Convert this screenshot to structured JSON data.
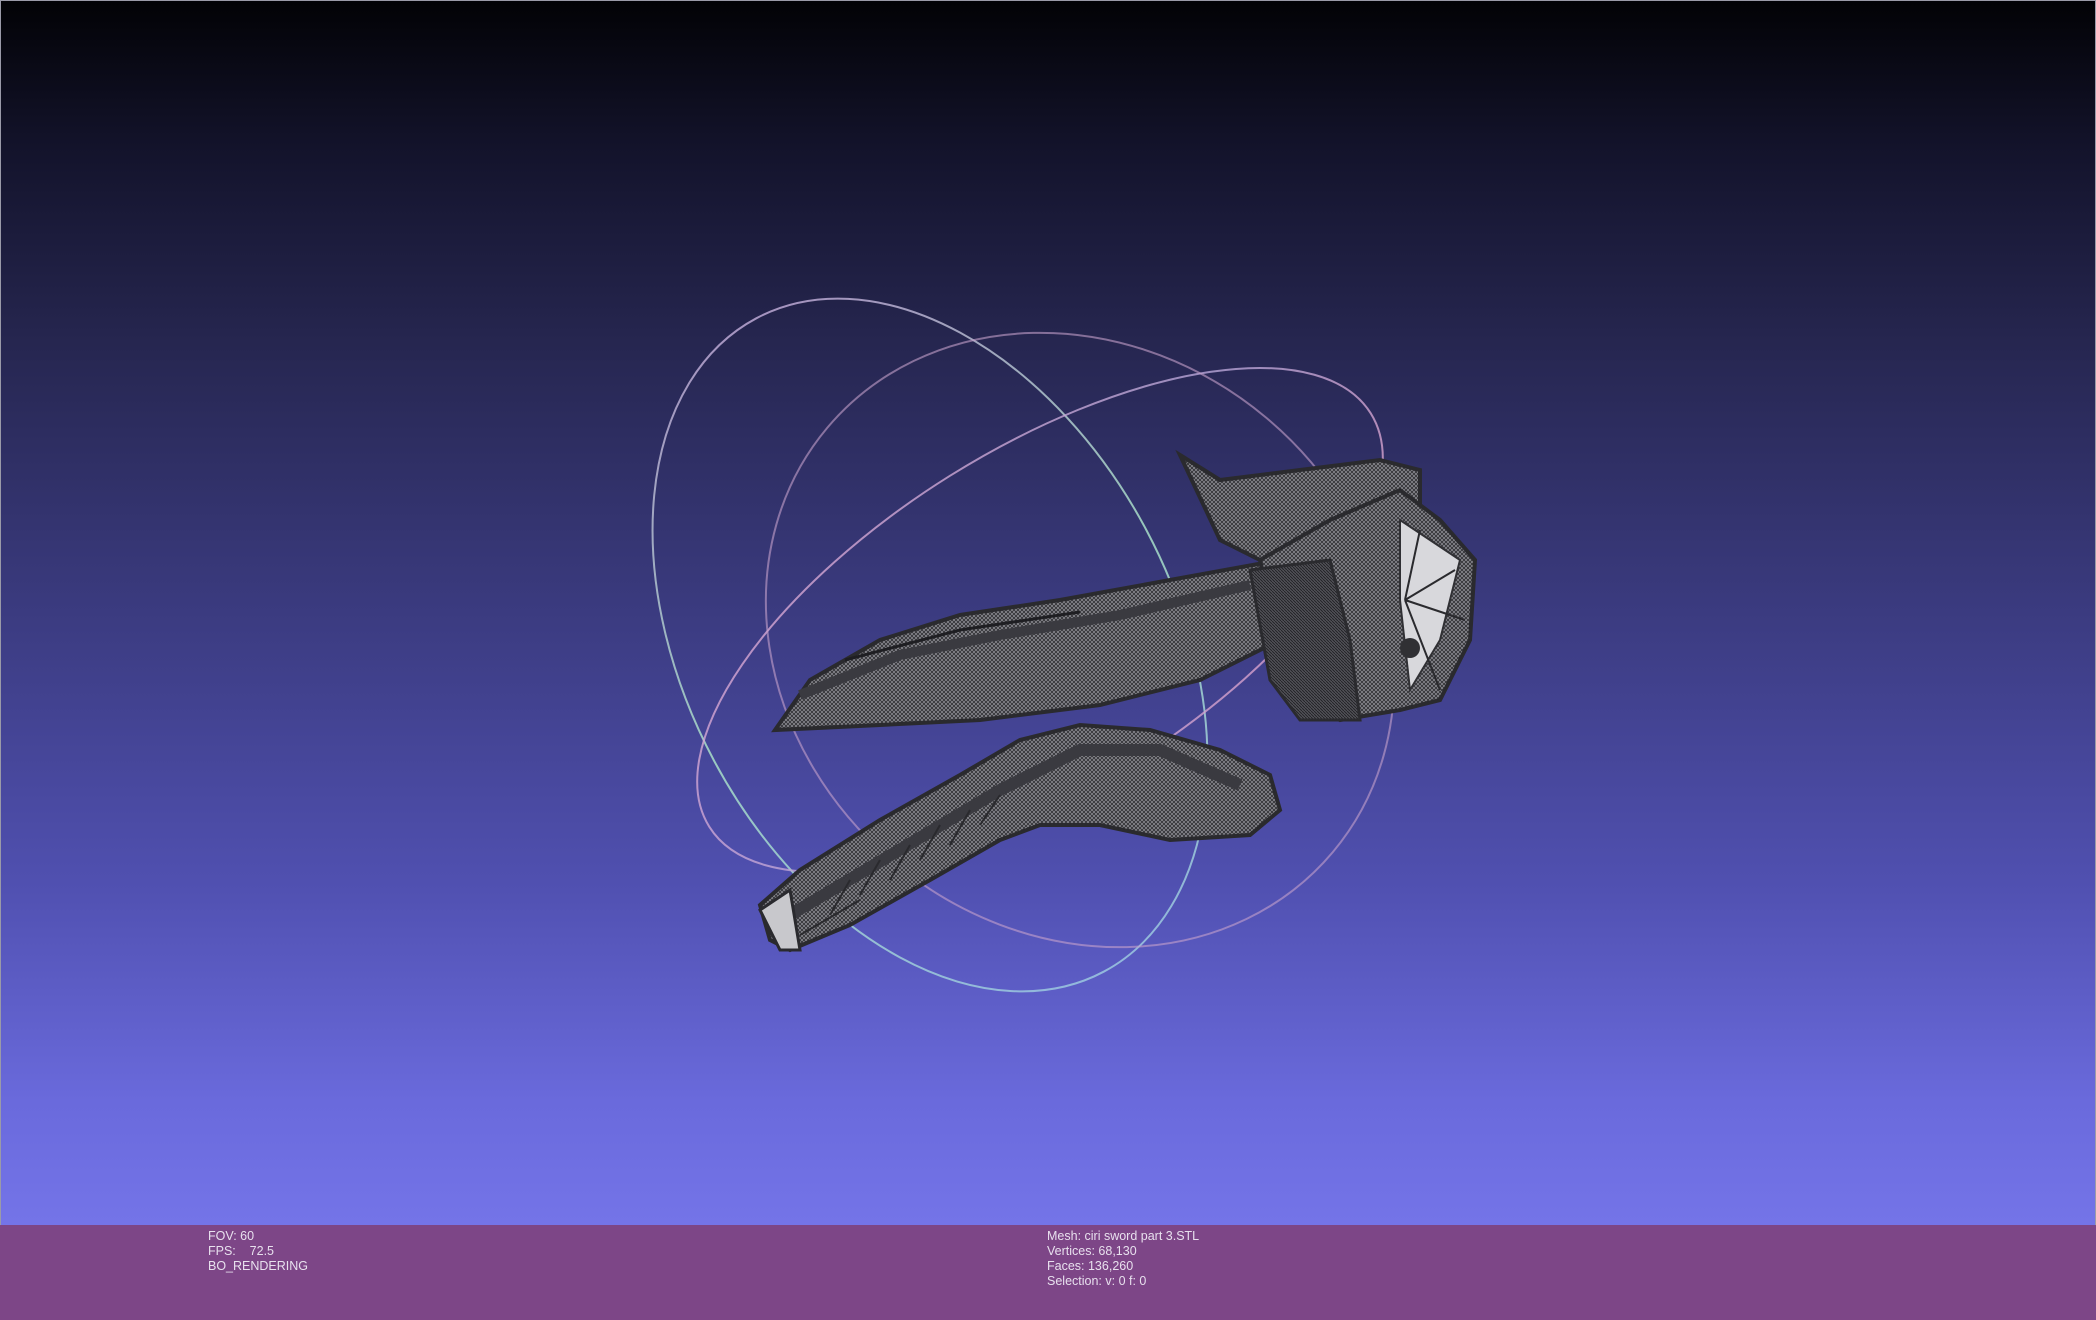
{
  "viewer": {
    "background_top": "#020205",
    "background_bottom": "#7474e8",
    "status_bar_color": "#7d4687",
    "mesh_color": "#6e6e72",
    "wire_color": "#2a2a2c",
    "trackball_colors": [
      "#e8a0c8",
      "#a8d0c0",
      "#c0a0d8"
    ]
  },
  "status": {
    "fov": "FOV: 60",
    "fps": "FPS:    72.5",
    "render_mode": "BO_RENDERING",
    "mesh_name": "Mesh: ciri sword part 3.STL",
    "vertices": "Vertices: 68,130",
    "faces": "Faces: 136,260",
    "selection": "Selection: v: 0 f: 0"
  }
}
